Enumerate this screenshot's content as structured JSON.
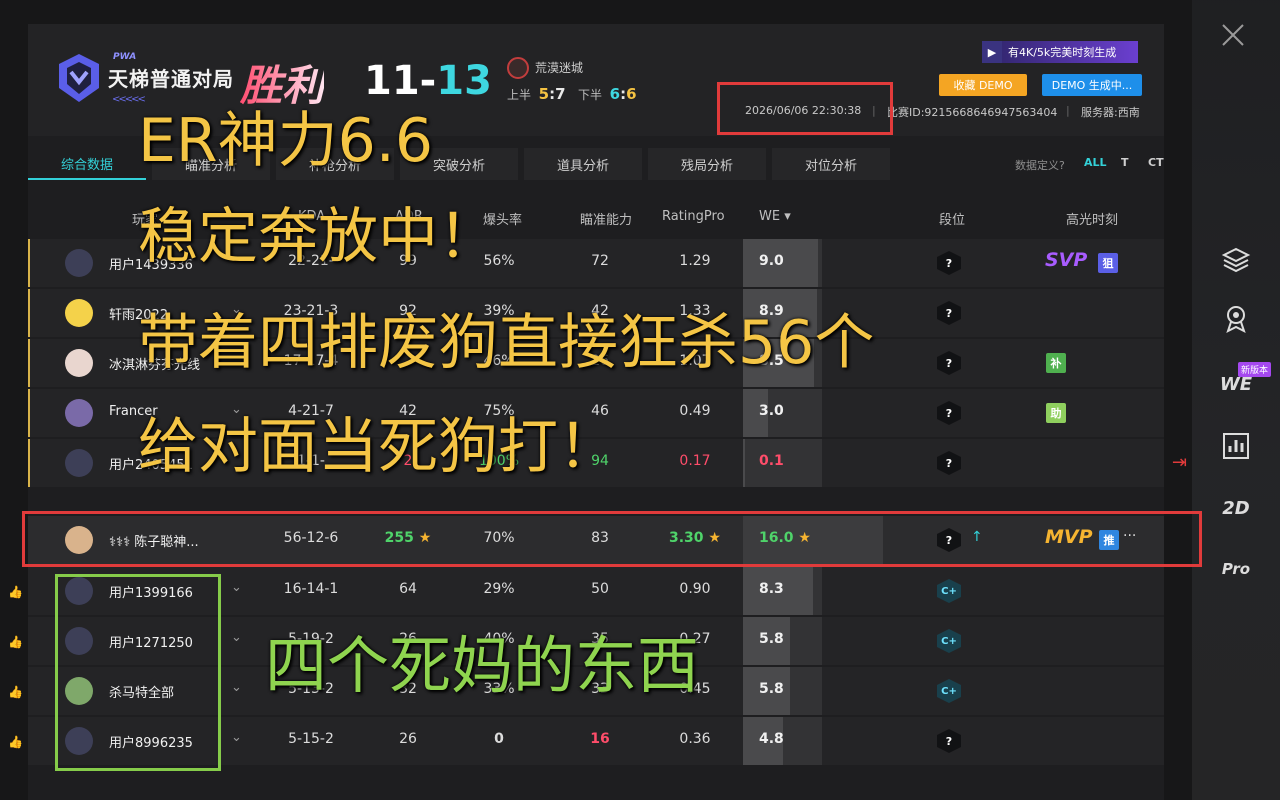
{
  "header": {
    "logo_tag": "PWA",
    "mode": "天梯普通对局",
    "result": "胜利",
    "score_left": "11",
    "score_sep": "-",
    "score_right": "13",
    "map": "荒漠迷城",
    "first_half_label": "上半",
    "first_half_score_a": "5",
    "first_half_sep": ":",
    "first_half_score_b": "7",
    "second_half_label": "下半",
    "second_half_score_a": "6",
    "second_half_sep": ":",
    "second_half_score_b": "6",
    "banner": "有4K/5k完美时刻生成",
    "collect_demo": "收藏 DEMO",
    "demo_generating": "DEMO 生成中...",
    "datetime": "2026/06/06 22:30:38",
    "match_id": "比赛ID:9215668646947563404",
    "server": "服务器:西南"
  },
  "tabs": [
    "综合数据",
    "瞄准分析",
    "补枪分析",
    "突破分析",
    "道具分析",
    "残局分析",
    "对位分析"
  ],
  "filter": {
    "label": "数据定义?",
    "all": "ALL",
    "t": "T",
    "ct": "CT"
  },
  "columns": {
    "player": "玩家",
    "kda": "KDA",
    "adr": "ADR",
    "hs": "爆头率",
    "aim": "瞄准能力",
    "rating": "RatingPro",
    "we": "WE ▾",
    "rank": "段位",
    "highlight": "高光时刻"
  },
  "team_a": [
    {
      "name": "用户1439336",
      "kda": "22-21-",
      "adr": "99",
      "hs": "56%",
      "aim": "72",
      "rating": "1.29",
      "we": "9.0",
      "we_frac": 0.95,
      "badge": "SVP",
      "tag": "狙"
    },
    {
      "name": "轩雨2022",
      "kda": "23-21-3",
      "adr": "92",
      "hs": "39%",
      "aim": "42",
      "rating": "1.33",
      "we": "8.9",
      "we_frac": 0.94,
      "badge": "",
      "tag": ""
    },
    {
      "name": "冰淇淋芬芬光线",
      "kda": "17-17-4",
      "adr": "",
      "hs": "46%",
      "aim": "26",
      "rating": "1.07",
      "we": "8.5",
      "we_frac": 0.9,
      "badge": "",
      "tag": "补"
    },
    {
      "name": "Francer",
      "kda": "4-21-7",
      "adr": "42",
      "hs": "75%",
      "aim": "46",
      "rating": "0.49",
      "we": "3.0",
      "we_frac": 0.32,
      "badge": "",
      "tag": "助"
    },
    {
      "name": "用户2405451",
      "kda": "1-1-",
      "adr": "2",
      "hs": "100%",
      "aim": "94",
      "rating": "0.17",
      "we": "0.1",
      "we_frac": 0.02,
      "badge": "",
      "tag": ""
    }
  ],
  "mvp_row": {
    "name": "⚕⚕⚕ 陈子聪神...",
    "kda": "56-12-6",
    "adr": "255",
    "hs": "70%",
    "aim": "83",
    "rating": "3.30",
    "we": "16.0",
    "we_frac": 1.0,
    "badge": "MVP",
    "tag": "推",
    "more": "···",
    "arrow": "↑"
  },
  "team_b": [
    {
      "name": "用户1399166",
      "kda": "16-14-1",
      "adr": "64",
      "hs": "29%",
      "aim": "50",
      "rating": "0.90",
      "we": "8.3",
      "we_frac": 0.88,
      "rank": "C+"
    },
    {
      "name": "用户1271250",
      "kda": "5-19-2",
      "adr": "26",
      "hs": "40%",
      "aim": "35",
      "rating": "0.27",
      "we": "5.8",
      "we_frac": 0.6,
      "rank": "C+"
    },
    {
      "name": "杀马特全部",
      "kda": "5-13-2",
      "adr": "32",
      "hs": "33%",
      "aim": "33",
      "rating": "0.45",
      "we": "5.8",
      "we_frac": 0.6,
      "rank": "C+"
    },
    {
      "name": "用户8996235",
      "kda": "5-15-2",
      "adr": "26",
      "hs": "0",
      "aim": "16",
      "rating": "0.36",
      "we": "4.8",
      "we_frac": 0.5,
      "rank": "?"
    }
  ],
  "overlay": {
    "line1": "ER神力6.6",
    "line2": "稳定奔放中！",
    "line3": "带着四排废狗直接狂杀56个",
    "line4": "给对面当死狗打！",
    "green": "四个死妈的东西"
  },
  "sidebar": {
    "we": "WE",
    "new_badge": "新版本",
    "two_d": "2D",
    "pro": "Pro"
  },
  "colors": {
    "accent": "#33d1d8",
    "gold": "#f4c545",
    "red_box": "#e13b3b",
    "green_box": "#86cc4a"
  }
}
